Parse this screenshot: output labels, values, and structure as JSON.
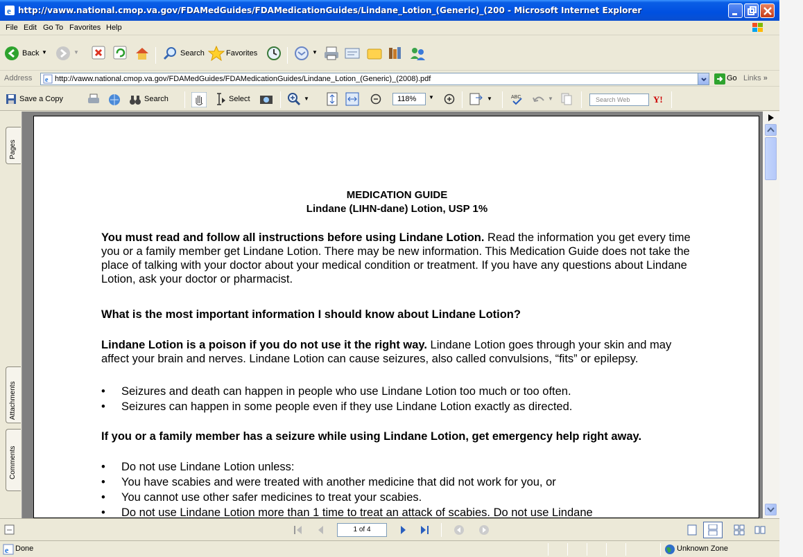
{
  "window": {
    "title": "http://vaww.national.cmop.va.gov/FDAMedGuides/FDAMedicationGuides/Lindane_Lotion_(Generic)_(200 - Microsoft Internet Explorer"
  },
  "menu": [
    "File",
    "Edit",
    "Go To",
    "Favorites",
    "Help"
  ],
  "toolbar": {
    "back": "Back",
    "search": "Search",
    "favorites": "Favorites"
  },
  "address": {
    "label": "Address",
    "url": "http://vaww.national.cmop.va.gov/FDAMedGuides/FDAMedicationGuides/Lindane_Lotion_(Generic)_(2008).pdf",
    "go": "Go",
    "links": "Links"
  },
  "adobe": {
    "save_copy": "Save a Copy",
    "search": "Search",
    "select": "Select",
    "zoom": "118%",
    "search_web": "Search Web",
    "yahoo": "Y!"
  },
  "sidepanel": {
    "tabs": [
      "Pages",
      "Attachments",
      "Comments"
    ]
  },
  "document": {
    "title_line1": "MEDICATION GUIDE",
    "title_line2": "Lindane (LIHN-dane) Lotion, USP 1%",
    "p1_bold": "You must read and follow all instructions before using Lindane Lotion.",
    "p1_rest": " Read the information you get every time you or a family member get Lindane Lotion. There may be new information. This Medication Guide does not take the place of talking with your doctor about your medical condition or treatment. If you have any questions about Lindane Lotion, ask your doctor or pharmacist.",
    "h1": "What is the most important information I should know about Lindane Lotion?",
    "p2_bold": "Lindane Lotion is a poison if you do not use it the right way.",
    "p2_rest": " Lindane Lotion goes through your skin and may affect your brain and nerves. Lindane Lotion can cause seizures, also called convulsions, “fits” or epilepsy.",
    "bullets1": [
      "Seizures and death can happen in people who use Lindane Lotion too much or too often.",
      "Seizures can happen in some people even if they use Lindane Lotion exactly as directed."
    ],
    "h2": "If you or a family member has a seizure while using Lindane Lotion, get emergency help right away.",
    "bullets2": [
      "Do not use Lindane Lotion unless:",
      "You have scabies and were treated with another medicine that did not work for you, or",
      "You cannot use other safer medicines to treat your scabies.",
      "Do not use Lindane Lotion more than 1 time to treat an attack of scabies. Do not use Lindane"
    ]
  },
  "nav": {
    "page": "1 of 4"
  },
  "status": {
    "text": "Done",
    "zone": "Unknown Zone"
  },
  "colors": {
    "titlebar": "#0050e0",
    "chrome": "#ece9d8",
    "pdf_bg": "#808080"
  }
}
